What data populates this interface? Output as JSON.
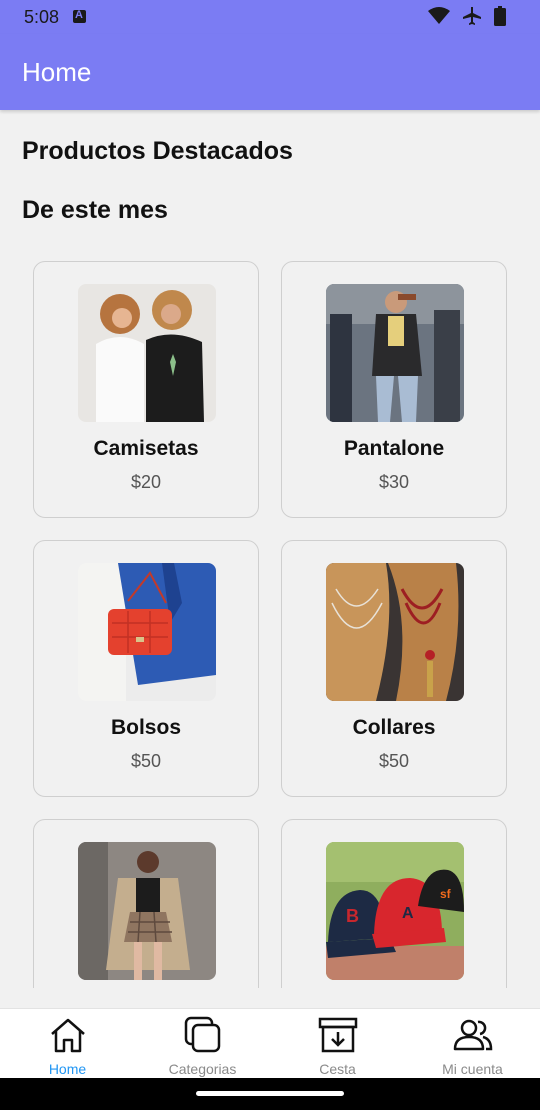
{
  "status": {
    "time": "5:08",
    "icons": [
      "notification-a-icon",
      "wifi-icon",
      "airplane-icon",
      "battery-icon"
    ]
  },
  "appbar": {
    "title": "Home"
  },
  "sections": {
    "featured": "Productos Destacados",
    "month": "De este mes"
  },
  "products": [
    {
      "name": "Camisetas",
      "price": "$20",
      "image": "two-women-tshirts"
    },
    {
      "name": "Pantalone",
      "price": "$30",
      "image": "street-style-jeans"
    },
    {
      "name": "Bolsos",
      "price": "$50",
      "image": "red-quilted-handbag"
    },
    {
      "name": "Collares",
      "price": "$50",
      "image": "necklaces-on-display"
    },
    {
      "name": "",
      "price": "",
      "image": "woman-plaid-skirt-coat"
    },
    {
      "name": "",
      "price": "",
      "image": "baseball-caps"
    }
  ],
  "nav": {
    "items": [
      {
        "label": "Home",
        "icon": "home-icon",
        "active": true
      },
      {
        "label": "Categorias",
        "icon": "categories-icon",
        "active": false
      },
      {
        "label": "Cesta",
        "icon": "basket-icon",
        "active": false
      },
      {
        "label": "Mi cuenta",
        "icon": "account-icon",
        "active": false
      }
    ]
  },
  "colors": {
    "primary": "#7b7cf3",
    "active_nav": "#2196f3",
    "background": "#f1f1f1"
  }
}
